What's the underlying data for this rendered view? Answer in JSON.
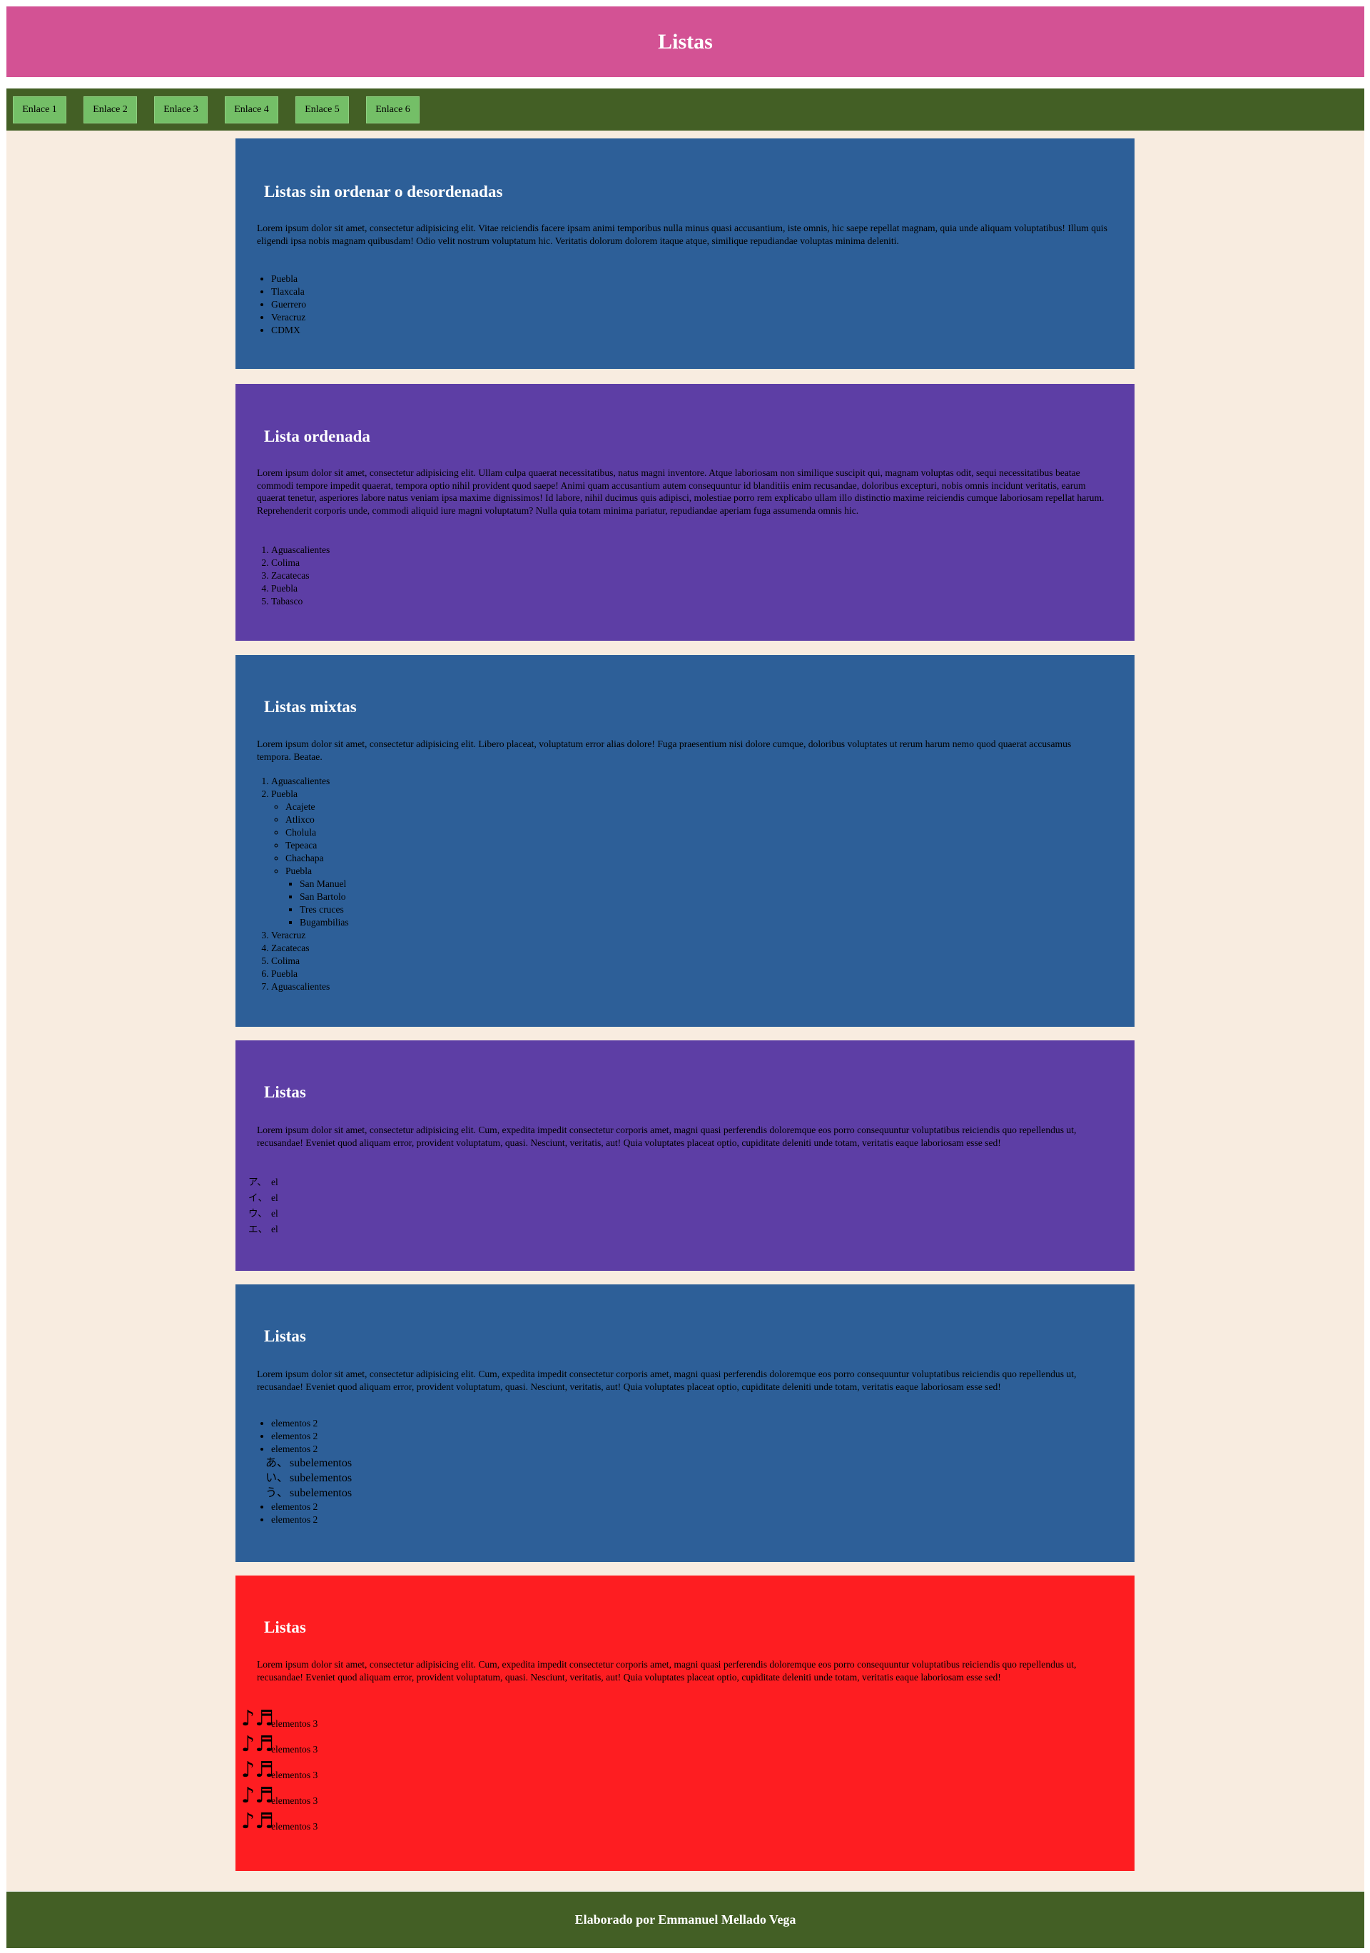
{
  "header": {
    "title": "Listas"
  },
  "nav": {
    "links": [
      "Enlace 1",
      "Enlace 2",
      "Enlace 3",
      "Enlace 4",
      "Enlace 5",
      "Enlace 6"
    ]
  },
  "sections": [
    {
      "title": "Listas sin ordenar o desordenadas",
      "text": "Lorem ipsum dolor sit amet, consectetur adipisicing elit. Vitae reiciendis facere ipsam animi temporibus nulla minus quasi accusantium, iste omnis, hic saepe repellat magnam, quia unde aliquam voluptatibus! Illum quis eligendi ipsa nobis magnam quibusdam! Odio velit nostrum voluptatum hic. Veritatis dolorum dolorem itaque atque, similique repudiandae voluptas minima deleniti.",
      "items": [
        "Puebla",
        "Tlaxcala",
        "Guerrero",
        "Veracruz",
        "CDMX"
      ]
    },
    {
      "title": "Lista ordenada",
      "text": "Lorem ipsum dolor sit amet, consectetur adipisicing elit. Ullam culpa quaerat necessitatibus, natus magni inventore. Atque laboriosam non similique suscipit qui, magnam voluptas odit, sequi necessitatibus beatae commodi tempore impedit quaerat, tempora optio nihil provident quod saepe! Animi quam accusantium autem consequuntur id blanditiis enim recusandae, doloribus excepturi, nobis omnis incidunt veritatis, earum quaerat tenetur, asperiores labore natus veniam ipsa maxime dignissimos! Id labore, nihil ducimus quis adipisci, molestiae porro rem explicabo ullam illo distinctio maxime reiciendis cumque laboriosam repellat harum. Reprehenderit corporis unde, commodi aliquid iure magni voluptatum? Nulla quia totam minima pariatur, repudiandae aperiam fuga assumenda omnis hic.",
      "items": [
        "Aguascalientes",
        "Colima",
        "Zacatecas",
        "Puebla",
        "Tabasco"
      ]
    },
    {
      "title": "Listas mixtas",
      "text": "Lorem ipsum dolor sit amet, consectetur adipisicing elit. Libero placeat, voluptatum error alias dolore! Fuga praesentium nisi dolore cumque, doloribus voluptates ut rerum harum nemo quod quaerat accusamus tempora. Beatae.",
      "items_before": [
        "Aguascalientes",
        "Puebla"
      ],
      "sub_items": [
        "Acajete",
        "Atlixco",
        "Cholula",
        "Tepeaca",
        "Chachapa",
        "Puebla"
      ],
      "sub_sub_items": [
        "San Manuel",
        "San Bartolo",
        "Tres cruces",
        "Bugambilias"
      ],
      "items_after": [
        "Veracruz",
        "Zacatecas",
        "Colima",
        "Puebla",
        "Aguascalientes"
      ]
    },
    {
      "title": "Listas",
      "text": "Lorem ipsum dolor sit amet, consectetur adipisicing elit. Cum, expedita impedit consectetur corporis amet, magni quasi perferendis doloremque eos porro consequuntur voluptatibus reiciendis quo repellendus ut, recusandae! Eveniet quod aliquam error, provident voluptatum, quasi. Nesciunt, veritatis, aut! Quia voluptates placeat optio, cupiditate deleniti unde totam, veritatis eaque laboriosam esse sed!",
      "markers": [
        "ア、",
        "イ、",
        "ウ、",
        "エ、"
      ],
      "items": [
        "el",
        "el",
        "el",
        "el"
      ]
    },
    {
      "title": "Listas",
      "text": "Lorem ipsum dolor sit amet, consectetur adipisicing elit. Cum, expedita impedit consectetur corporis amet, magni quasi perferendis doloremque eos porro consequuntur voluptatibus reiciendis quo repellendus ut, recusandae! Eveniet quod aliquam error, provident voluptatum, quasi. Nesciunt, veritatis, aut! Quia voluptates placeat optio, cupiditate deleniti unde totam, veritatis eaque laboriosam esse sed!",
      "items_before": [
        "elementos 2",
        "elementos 2",
        "elementos 2"
      ],
      "sub_markers": [
        "あ、",
        "い、",
        "う、"
      ],
      "sub_items": [
        "subelementos",
        "subelementos",
        "subelementos"
      ],
      "items_after": [
        "elementos 2",
        "elementos 2"
      ]
    },
    {
      "title": "Listas",
      "text": "Lorem ipsum dolor sit amet, consectetur adipisicing elit. Cum, expedita impedit consectetur corporis amet, magni quasi perferendis doloremque eos porro consequuntur voluptatibus reiciendis quo repellendus ut, recusandae! Eveniet quod aliquam error, provident voluptatum, quasi. Nesciunt, veritatis, aut! Quia voluptates placeat optio, cupiditate deleniti unde totam, veritatis eaque laboriosam esse sed!",
      "marker": "♪♬",
      "items": [
        "elementos 3",
        "elementos 3",
        "elementos 3",
        "elementos 3",
        "elementos 3"
      ]
    }
  ],
  "footer": {
    "text": "Elaborado por Emmanuel Mellado Vega"
  },
  "colors": {
    "header": "#d35294",
    "nav": "#435f25",
    "nav_link": "#74bf67",
    "main_bg": "#f8ece0",
    "blue": "#2d5f98",
    "purple": "#5d3ea5",
    "red": "#fe1d21"
  }
}
